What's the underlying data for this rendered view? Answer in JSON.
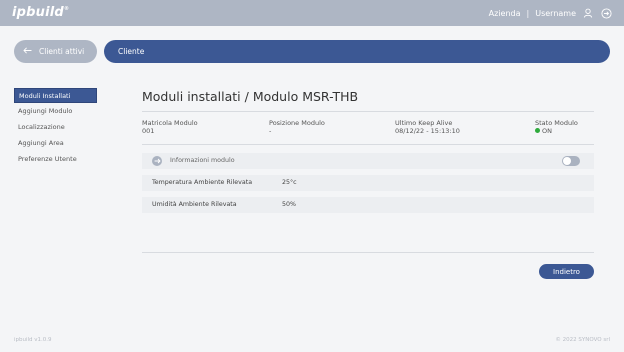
{
  "header": {
    "logo": "ipbuild",
    "logo_mark": "®",
    "company": "Azienda",
    "separator": "|",
    "username": "Username",
    "user_icon": "user-icon",
    "logout_icon": "logout-icon"
  },
  "nav": {
    "back_label": "Clienti attivi",
    "section_label": "Cliente"
  },
  "sidebar": {
    "items": [
      {
        "label": "Moduli Installati",
        "active": true
      },
      {
        "label": "Aggiungi Modulo",
        "active": false
      },
      {
        "label": "Localizzazione",
        "active": false
      },
      {
        "label": "Aggiungi Area",
        "active": false
      },
      {
        "label": "Preferenze Utente",
        "active": false
      }
    ]
  },
  "main": {
    "title": "Moduli installati / Modulo MSR-THB",
    "info": {
      "serial_label": "Matricola Modulo",
      "serial_value": "001",
      "position_label": "Posizione Modulo",
      "position_value": "-",
      "keepalive_label": "Ultimo Keep Alive",
      "keepalive_value": "08/12/22 - 15:13:10",
      "status_label": "Stato Modulo",
      "status_value": "ON",
      "status_color": "#2eaa3c"
    },
    "module_info": {
      "label": "Informazioni modulo",
      "toggle_on": false
    },
    "readings": [
      {
        "label": "Temperatura Ambiente Rilevata",
        "value": "25°c"
      },
      {
        "label": "Umidità Ambiente Rilevata",
        "value": "50%"
      }
    ],
    "back_button": "Indietro"
  },
  "footer": {
    "version": "ipbuild v1.0.9",
    "copyright": "© 2022 SYNOVO srl"
  },
  "colors": {
    "topbar": "#aeb6c4",
    "primary": "#3c5894",
    "background": "#f4f5f7"
  }
}
